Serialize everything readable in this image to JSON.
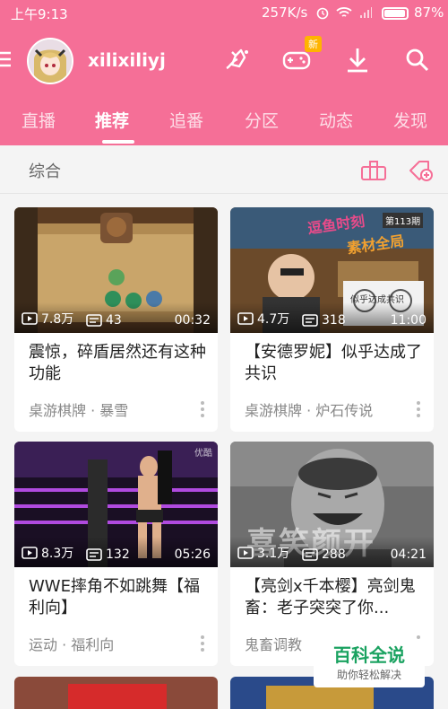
{
  "status_bar": {
    "time": "上午9:13",
    "speed": "257K/s",
    "battery": "87%"
  },
  "toolbar": {
    "username": "xilixiliyj",
    "new_badge": "新",
    "icons": [
      "menu-icon",
      "avatar",
      "game-center-icon",
      "gamepad-icon",
      "download-icon",
      "search-icon"
    ]
  },
  "tabs": [
    {
      "label": "直播"
    },
    {
      "label": "推荐"
    },
    {
      "label": "追番"
    },
    {
      "label": "分区"
    },
    {
      "label": "动态"
    },
    {
      "label": "发现"
    }
  ],
  "active_tab": "推荐",
  "subbar": {
    "title": "综合"
  },
  "cards": [
    {
      "views": "7.8万",
      "danmaku": "43",
      "duration": "00:32",
      "title": "震惊，碎盾居然还有这种功能",
      "category": "桌游棋牌 · 暴雪"
    },
    {
      "views": "4.7万",
      "danmaku": "318",
      "duration": "11:00",
      "title": "【安德罗妮】似乎达成了共识",
      "category": "桌游棋牌 · 炉石传说",
      "thumb_text": [
        "逗鱼时刻",
        "第113期",
        "素材全局",
        "似乎达成共识"
      ]
    },
    {
      "views": "8.3万",
      "danmaku": "132",
      "duration": "05:26",
      "title": "WWE摔角不如跳舞【福利向】",
      "category": "运动 · 福利向",
      "thumb_text": [
        "优酷"
      ]
    },
    {
      "views": "3.1万",
      "danmaku": "288",
      "duration": "04:21",
      "title": "【亮剑x千本樱】亮剑鬼畜：老子突突了你...",
      "category": "鬼畜调教",
      "thumb_text": [
        "喜笑颜开"
      ]
    }
  ],
  "watermark": {
    "title": "百科全说",
    "subtitle": "助你轻松解决"
  },
  "colors": {
    "brand_pink": "#f56f97",
    "background": "#f4f4f4"
  }
}
